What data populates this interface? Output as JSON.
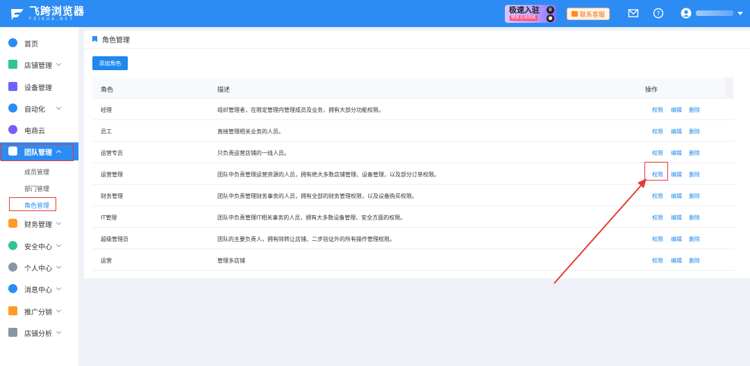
{
  "header": {
    "logo_title": "飞跨浏览器",
    "logo_sub": "FEIKUA.NET",
    "promo_title": "极速入驻",
    "promo_sub": "畅享全球商机",
    "service_label": "联系客服",
    "accent": "#2c8cf4"
  },
  "sidebar": {
    "items": [
      {
        "label": "首页",
        "icon": "home-icon",
        "color": "#2c8cf4"
      },
      {
        "label": "店铺管理",
        "icon": "store-icon",
        "color": "#32c48d"
      },
      {
        "label": "设备管理",
        "icon": "device-icon",
        "color": "#6c63ff"
      },
      {
        "label": "自动化",
        "icon": "robot-icon",
        "color": "#2c8cf4"
      },
      {
        "label": "电商云",
        "icon": "cloud-icon",
        "color": "#7a5cf5"
      },
      {
        "label": "团队管理",
        "icon": "team-icon",
        "color": "#ffffff"
      },
      {
        "label": "财务管理",
        "icon": "finance-icon",
        "color": "#ff9b26"
      },
      {
        "label": "安全中心",
        "icon": "shield-icon",
        "color": "#32c48d"
      },
      {
        "label": "个人中心",
        "icon": "user-icon",
        "color": "#8a94a6"
      },
      {
        "label": "消息中心",
        "icon": "bell-icon",
        "color": "#2c8cf4"
      },
      {
        "label": "推广分销",
        "icon": "megaphone-icon",
        "color": "#ff9b26"
      },
      {
        "label": "店铺分析",
        "icon": "analysis-icon",
        "color": "#8a94a6"
      }
    ],
    "sub_items": [
      "成员管理",
      "部门管理",
      "角色管理"
    ]
  },
  "page": {
    "breadcrumb": "角色管理",
    "add_button": "添加角色"
  },
  "table": {
    "headers": [
      "角色",
      "描述",
      "操作"
    ],
    "actions": [
      "权限",
      "编辑",
      "删除"
    ],
    "rows": [
      {
        "role": "经理",
        "desc": "组织管理者，在限定管理内管理成员及业务，拥有大部分功能权限。"
      },
      {
        "role": "员工",
        "desc": "直接管理相关业务的人员。"
      },
      {
        "role": "运营专员",
        "desc": "只负责运营店铺的一线人员。"
      },
      {
        "role": "运营管理",
        "desc": "团队中负责管理运营资源的人员，拥有绝大多数店铺管理、设备管理，以及部分订单权限。"
      },
      {
        "role": "财务管理",
        "desc": "团队中负责管理财务事务的人员，拥有全部的财务管理权限，以及设备购买权限。"
      },
      {
        "role": "IT管理",
        "desc": "团队中负责管理IT相关事务的人员，拥有大多数设备管理、安全方面的权限。"
      },
      {
        "role": "超级管理员",
        "desc": "团队的主要负责人，拥有除转让店铺、二步验证外的所有操作管理权限。"
      },
      {
        "role": "运营",
        "desc": "管理多店铺"
      }
    ]
  }
}
